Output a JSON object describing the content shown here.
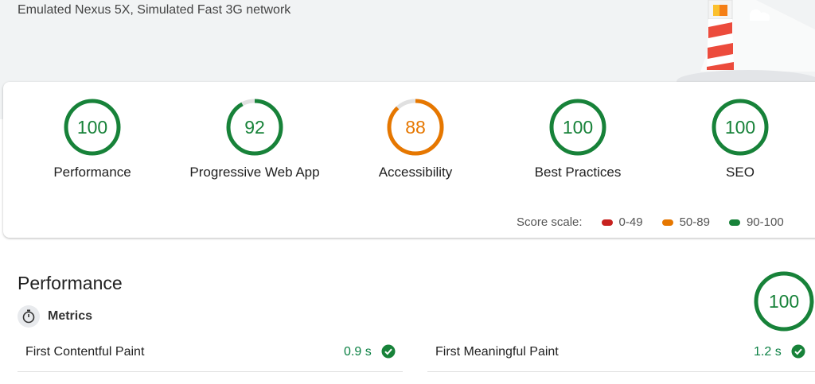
{
  "header": {
    "environment": "Emulated Nexus 5X, Simulated Fast 3G network"
  },
  "scores": [
    {
      "label": "Performance",
      "score": "100",
      "color": "#178239"
    },
    {
      "label": "Progressive Web App",
      "score": "92",
      "color": "#178239"
    },
    {
      "label": "Accessibility",
      "score": "88",
      "color": "#e67700"
    },
    {
      "label": "Best Practices",
      "score": "100",
      "color": "#178239"
    },
    {
      "label": "SEO",
      "score": "100",
      "color": "#178239"
    }
  ],
  "score_scale": {
    "label": "Score scale:",
    "ranges": [
      {
        "text": "0-49",
        "color": "#c7221f"
      },
      {
        "text": "50-89",
        "color": "#e67700"
      },
      {
        "text": "90-100",
        "color": "#178239"
      }
    ]
  },
  "section": {
    "title": "Performance",
    "score": "100",
    "metrics_label": "Metrics",
    "metrics": [
      {
        "name": "First Contentful Paint",
        "value": "0.9 s"
      },
      {
        "name": "First Meaningful Paint",
        "value": "1.2 s"
      }
    ]
  }
}
